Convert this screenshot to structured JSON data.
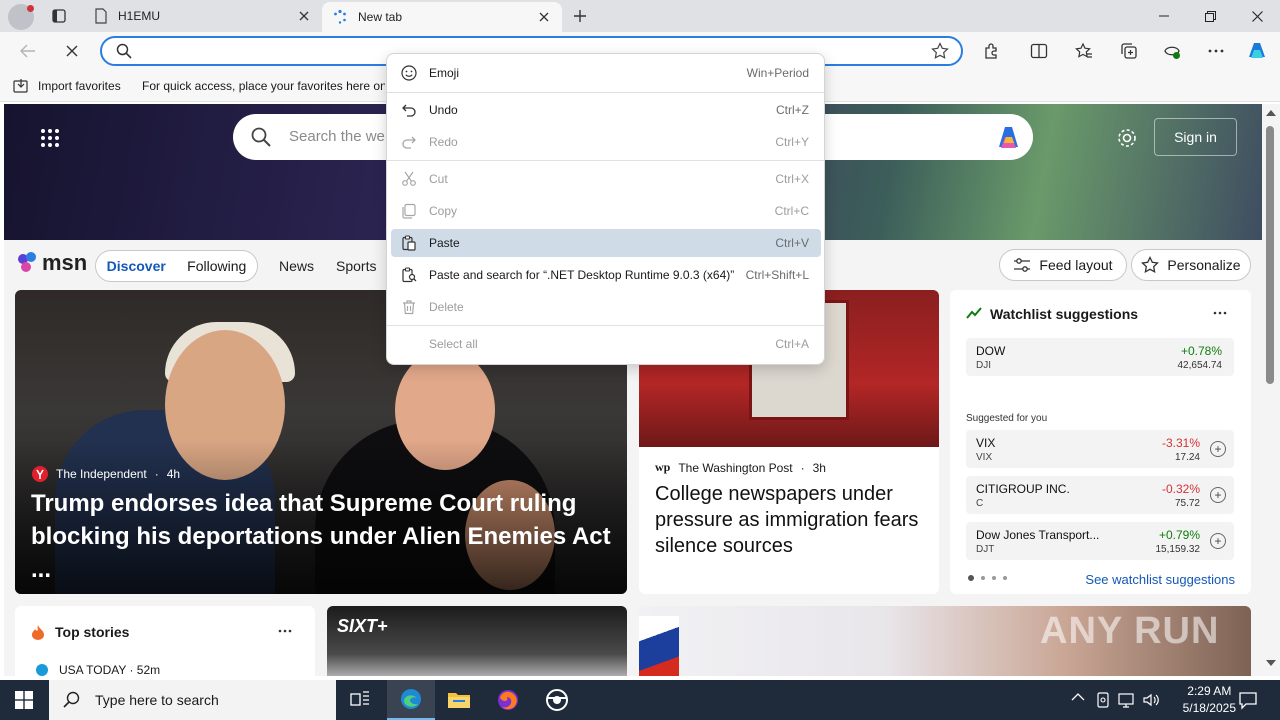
{
  "browser": {
    "tabs": [
      {
        "title": "H1EMU"
      },
      {
        "title": "New tab"
      }
    ],
    "address": {
      "value": "",
      "placeholder": ""
    },
    "favorites_bar": {
      "import_label": "Import favorites",
      "hint": "For quick access, place your favorites here on t"
    }
  },
  "msn": {
    "search_placeholder": "Search the we",
    "sign_in": "Sign in",
    "logo": "msn",
    "tabs": [
      "Discover",
      "Following"
    ],
    "nav": [
      "News",
      "Sports"
    ],
    "feed_layout": "Feed layout",
    "personalize": "Personalize",
    "hero": {
      "source": "The Independent",
      "age": "4h",
      "title": "Trump endorses idea that Supreme Court ruling blocking his deportations under Alien Enemies Act ..."
    },
    "story2": {
      "source": "The Washington Post",
      "age": "3h",
      "title": "College newspapers under pressure as immigration fears silence sources"
    },
    "watchlist": {
      "title": "Watchlist suggestions",
      "main": {
        "name": "DOW",
        "symbol": "DJI",
        "change": "+0.78%",
        "price": "42,654.74"
      },
      "suggested_label": "Suggested for you",
      "items": [
        {
          "name": "VIX",
          "symbol": "VIX",
          "change": "-3.31%",
          "price": "17.24"
        },
        {
          "name": "CITIGROUP INC.",
          "symbol": "C",
          "change": "-0.32%",
          "price": "75.72"
        },
        {
          "name": "Dow Jones Transport...",
          "symbol": "DJT",
          "change": "+0.79%",
          "price": "15,159.32"
        }
      ],
      "see_all": "See watchlist suggestions"
    },
    "top_stories": {
      "title": "Top stories",
      "first_source": "USA TODAY · 52m"
    },
    "ad_brand": "SIXT+"
  },
  "context_menu": {
    "items": [
      {
        "label": "Emoji",
        "shortcut": "Win+Period",
        "icon": "emoji-icon",
        "disabled": false
      },
      {
        "label": "Undo",
        "shortcut": "Ctrl+Z",
        "icon": "undo-icon",
        "disabled": false
      },
      {
        "label": "Redo",
        "shortcut": "Ctrl+Y",
        "icon": "redo-icon",
        "disabled": true
      },
      {
        "label": "Cut",
        "shortcut": "Ctrl+X",
        "icon": "cut-icon",
        "disabled": true
      },
      {
        "label": "Copy",
        "shortcut": "Ctrl+C",
        "icon": "copy-icon",
        "disabled": true
      },
      {
        "label": "Paste",
        "shortcut": "Ctrl+V",
        "icon": "paste-icon",
        "disabled": false,
        "highlighted": true
      },
      {
        "label": "Paste and search for “.NET Desktop Runtime 9.0.3 (x64)”",
        "shortcut": "Ctrl+Shift+L",
        "icon": "paste-search-icon",
        "disabled": false
      },
      {
        "label": "Delete",
        "shortcut": "",
        "icon": "delete-icon",
        "disabled": true
      },
      {
        "label": "Select all",
        "shortcut": "Ctrl+A",
        "icon": "",
        "disabled": true
      }
    ]
  },
  "taskbar": {
    "search_placeholder": "Type here to search",
    "time": "2:29 AM",
    "date": "5/18/2025"
  },
  "watermark": "ANY RUN",
  "colors": {
    "accent": "#2a7de1",
    "positive": "#107c10",
    "negative": "#d13438",
    "menu_highlight": "#cfdce8",
    "taskbar": "#1f2a3a"
  }
}
